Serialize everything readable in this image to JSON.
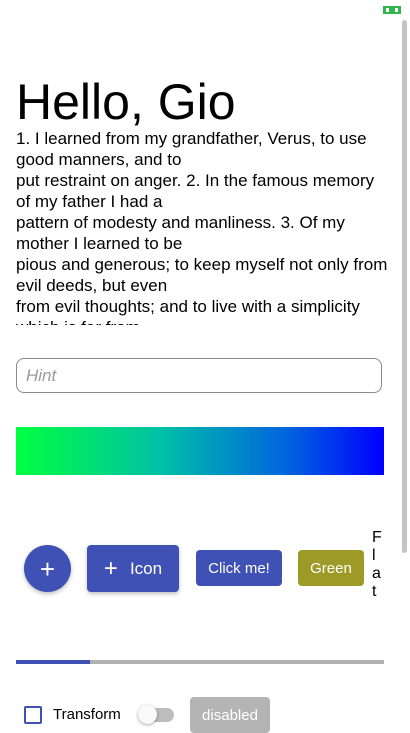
{
  "status_bar": {
    "icon": "battery-icon",
    "accent": "#2eb84b"
  },
  "title": "Hello, Gio",
  "paragraph": "1. I learned from my grandfather, Verus, to use good manners, and to\nput restraint on anger. 2. In the famous memory of my father I had a\npattern of modesty and manliness. 3. Of my mother I learned to be\npious and generous; to keep myself not only from evil deeds, but even\nfrom evil thoughts; and to live with a simplicity which is far from",
  "editor": {
    "placeholder": "Hint"
  },
  "gradient": {
    "from": "#00ff40",
    "to": "#0000ff"
  },
  "buttons": {
    "fab_label": "+",
    "icon_button_glyph": "+",
    "icon_button_label": "Icon",
    "click_me": "Click me!",
    "green": "Green",
    "flat": "F\nl\na\nt"
  },
  "progress": {
    "fraction": 0.2
  },
  "checkbox": {
    "label": "Transform",
    "checked": false
  },
  "switch": {
    "on": false
  },
  "disabled_button": "disabled",
  "colors": {
    "primary": "#3f51b5",
    "green_button": "#9e9a28",
    "disabled": "#b4b4b4"
  }
}
